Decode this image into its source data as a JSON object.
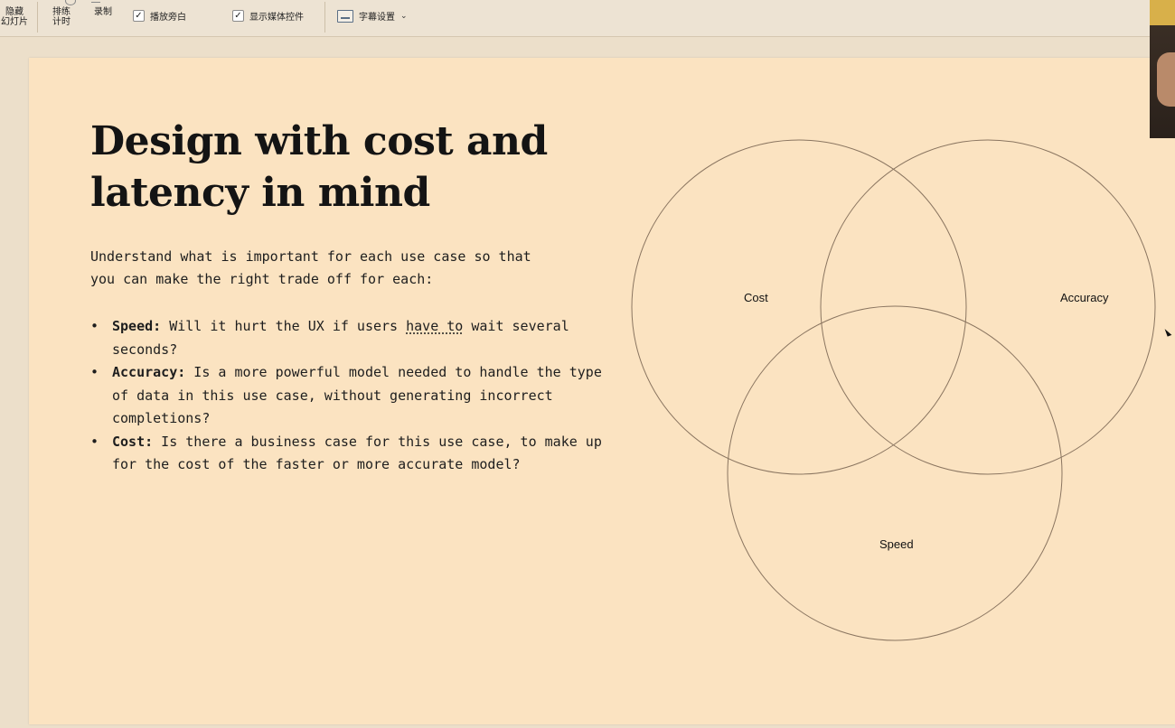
{
  "ribbon": {
    "hide_slide": {
      "line1": "隐藏",
      "line2": "幻灯片"
    },
    "rehearse_timings": {
      "line1": "排练",
      "line2": "计时"
    },
    "record": "录制",
    "play_narrations": {
      "label": "播放旁白",
      "checked": true
    },
    "show_media_controls": {
      "label": "显示媒体控件",
      "checked": true
    },
    "subtitle_settings": "字幕设置"
  },
  "slide": {
    "title_line1": "Design with cost and",
    "title_line2": "latency in mind",
    "intro_line1": "Understand what is important for each use case so that",
    "intro_line2": "you can make the right trade off for each:",
    "bullets": [
      {
        "term": "Speed:",
        "text_pre": " Will it hurt the UX if users ",
        "text_underlined": "have to",
        "text_post": " wait several seconds?"
      },
      {
        "term": "Accuracy:",
        "text": " Is a more powerful model needed to handle the type of data in this use case, without generating incorrect completions?"
      },
      {
        "term": "Cost:",
        "text": " Is there a business case for this use case, to make up for the cost of the faster or more accurate model?"
      }
    ],
    "venn": {
      "labels": [
        "Cost",
        "Accuracy",
        "Speed"
      ],
      "stroke_color": "#8a7560"
    }
  },
  "colors": {
    "slide_bg": "#fbe3c1",
    "app_bg": "#ecdfca",
    "text": "#141414"
  }
}
